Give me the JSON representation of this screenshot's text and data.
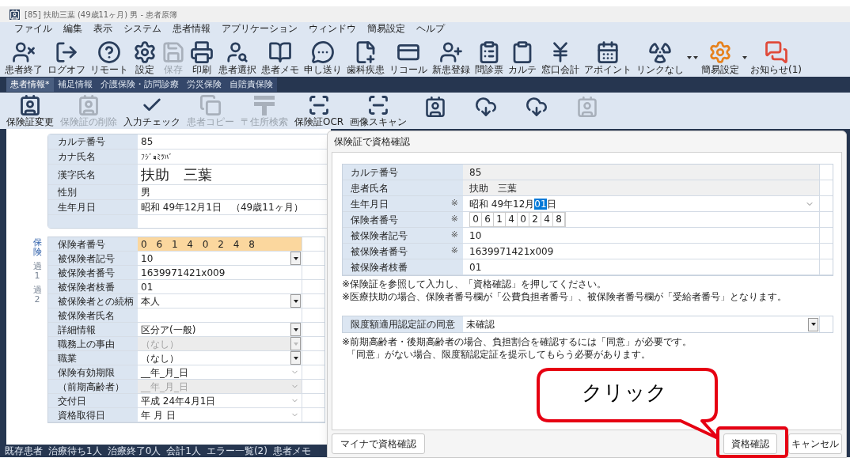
{
  "window": {
    "title": "[85] 扶助三葉 (49歳11ヶ月) 男 - 患者原簿"
  },
  "menu": [
    "ファイル",
    "編集",
    "表示",
    "システム",
    "患者情報",
    "アプリケーション",
    "ウィンドウ",
    "簡易設定",
    "ヘルプ"
  ],
  "toolbar": [
    {
      "kind": "button",
      "label": "患者終了",
      "disabled": false
    },
    {
      "kind": "button",
      "label": "ログオフ",
      "disabled": false
    },
    {
      "kind": "button",
      "label": "リモート",
      "disabled": false
    },
    {
      "kind": "button",
      "label": "設定",
      "disabled": false
    },
    {
      "kind": "button",
      "label": "保存",
      "disabled": true
    },
    {
      "kind": "button",
      "label": "印刷",
      "disabled": false
    },
    {
      "kind": "button",
      "label": "患者選択",
      "disabled": false
    },
    {
      "kind": "button",
      "label": "患者メモ",
      "disabled": false
    },
    {
      "kind": "button",
      "label": "申し送り",
      "disabled": false
    },
    {
      "kind": "button",
      "label": "歯科疾患",
      "disabled": false
    },
    {
      "kind": "button",
      "label": "リコール",
      "disabled": false
    },
    {
      "kind": "button",
      "label": "新患登録",
      "disabled": false
    },
    {
      "kind": "button",
      "label": "問診票",
      "disabled": false
    },
    {
      "kind": "button",
      "label": "カルテ",
      "disabled": false
    },
    {
      "kind": "button",
      "label": "窓口会計",
      "disabled": false
    },
    {
      "kind": "button",
      "label": "アポイント",
      "disabled": false
    },
    {
      "kind": "button",
      "label": "リンクなし",
      "disabled": false
    },
    {
      "kind": "caret"
    },
    {
      "kind": "caret"
    },
    {
      "kind": "button",
      "label": "簡易設定",
      "disabled": false
    },
    {
      "kind": "caret"
    },
    {
      "kind": "button",
      "label": "お知らせ(1)",
      "disabled": false
    }
  ],
  "tabs": [
    {
      "label": "患者情報*",
      "selected": true
    },
    {
      "label": "補足情報",
      "selected": false
    },
    {
      "label": "介護保険・訪問診療",
      "selected": false
    },
    {
      "label": "労災保険",
      "selected": false
    },
    {
      "label": "自賠責保険",
      "selected": false
    }
  ],
  "subtoolbar": [
    {
      "label": "保険証変更",
      "disabled": false
    },
    {
      "label": "保険証の削除",
      "disabled": true
    },
    {
      "label": "入力チェック",
      "disabled": false
    },
    {
      "label": "患者コピー",
      "disabled": true
    },
    {
      "label": "〒住所検索",
      "disabled": true
    },
    {
      "label": "保険証OCR",
      "disabled": false
    },
    {
      "label": "画像スキャン",
      "disabled": false
    }
  ],
  "subtoolbar_hidden_icons": [
    {
      "disabled": false
    },
    {
      "disabled": false
    },
    {
      "disabled": false
    },
    {
      "disabled": true
    }
  ],
  "patient": {
    "rows": [
      {
        "kind": "text",
        "label": "カルテ番号",
        "value": "85"
      },
      {
        "kind": "kana",
        "label": "カナ氏名",
        "value": "ﾌｼﾞｮﾐﾂﾊﾞ"
      },
      {
        "kind": "name",
        "label": "漢字氏名",
        "value": "扶助　三葉"
      },
      {
        "kind": "text",
        "label": "性別",
        "value": "男"
      },
      {
        "kind": "text",
        "label": "生年月日",
        "value": "昭和 49年12月1日　（49歳11ヶ月）"
      }
    ]
  },
  "insurance": {
    "side_tabs": [
      {
        "label": "保険",
        "selected": true
      },
      {
        "label": "過1",
        "selected": false
      },
      {
        "label": "過2",
        "selected": false
      }
    ],
    "rows": [
      {
        "kind": "highlight",
        "label": "保険者番号",
        "value": "0 6 1 4 0 2 4 8",
        "disabled": false
      },
      {
        "kind": "select",
        "label": "被保険者記号",
        "value": "10",
        "disabled": false
      },
      {
        "kind": "text",
        "label": "被保険者番号",
        "value": "1639971421x009",
        "disabled": false
      },
      {
        "kind": "text",
        "label": "被保険者枝番",
        "value": "01",
        "disabled": false
      },
      {
        "kind": "select",
        "label": "被保険者との続柄",
        "value": "本人",
        "disabled": false
      },
      {
        "kind": "text",
        "label": "被保険者氏名",
        "disabled": false
      },
      {
        "kind": "select",
        "label": "詳細情報",
        "value": "区分ア(一般)",
        "disabled": false
      },
      {
        "kind": "select",
        "label": "職務上の事由",
        "value": "（なし）",
        "disabled": true
      },
      {
        "kind": "select",
        "label": "職業",
        "value": "（なし）",
        "disabled": false
      },
      {
        "kind": "date",
        "label": "保険有効期限",
        "value": "__年_月_日",
        "disabled": false
      },
      {
        "kind": "date",
        "label": "（前期高齢者）",
        "value": "__年_月_日",
        "disabled": true
      },
      {
        "kind": "date",
        "label": "交付日",
        "value": "平成 24年4月1日",
        "disabled": false
      },
      {
        "kind": "date",
        "label": "資格取得日",
        "value": "年 月 日",
        "disabled": false
      }
    ]
  },
  "dialog": {
    "title": "保険証で資格確認",
    "rows": [
      {
        "kind": "readonly",
        "label": "カルテ番号",
        "value": "85"
      },
      {
        "kind": "readonly",
        "label": "患者氏名",
        "value": "扶助　三葉"
      },
      {
        "kind": "date",
        "label": "生年月日",
        "mark": "※",
        "prefix": "昭和 49年12月",
        "selection": "01",
        "suffix": "日"
      },
      {
        "kind": "digits",
        "label": "保険者番号",
        "mark": "※",
        "digits": [
          "0",
          "6",
          "1",
          "4",
          "0",
          "2",
          "4",
          "8"
        ]
      },
      {
        "kind": "text",
        "label": "被保険者記号",
        "mark": "※",
        "value": "10"
      },
      {
        "kind": "text",
        "label": "被保険者番号",
        "mark": "※",
        "value": "1639971421x009"
      },
      {
        "kind": "text",
        "label": "被保険者枝番",
        "value": "01"
      }
    ],
    "notes": [
      "※保険証を参照して入力し、「資格確認」を押してください。",
      "※医療扶助の場合、保険者番号欄が「公費負担者番号」、被保険者番号欄が「受給者番号」となります。"
    ],
    "consent": {
      "label": "限度額適用認定証の同意",
      "value": "未確認"
    },
    "consent_notes": [
      "※前期高齢者・後期高齢者の場合、負担割合を確認するには「同意」が必要です。",
      "「同意」がない場合、限度額認定証を提示してもらう必要があります。"
    ],
    "buttons": {
      "mynumber": "マイナで資格確認",
      "confirm": "資格確認",
      "cancel": "キャンセル"
    }
  },
  "callout": {
    "text": "クリック"
  },
  "status_bar": [
    "既存患者",
    "治療待ち1人",
    "治療終了0人",
    "会計1人",
    "エラー一覧(2)",
    "患者メモ"
  ]
}
